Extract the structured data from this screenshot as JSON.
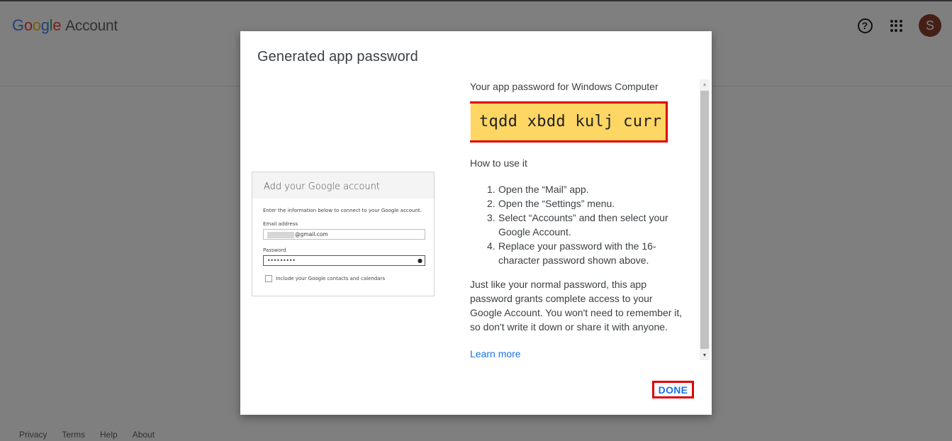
{
  "header": {
    "logo_letters": [
      "G",
      "o",
      "o",
      "g",
      "l",
      "e"
    ],
    "logo_suffix": "Account",
    "help_icon": "help-circle-icon",
    "apps_icon": "apps-grid-icon",
    "avatar_initial": "S",
    "avatar_color": "#8a3e2c"
  },
  "footer": {
    "links": [
      "Privacy",
      "Terms",
      "Help",
      "About"
    ]
  },
  "dialog": {
    "title": "Generated app password",
    "illustration": {
      "title": "Add your Google account",
      "description": "Enter the information below to connect to your Google account.",
      "email_label": "Email address",
      "email_value": "@gmail.com",
      "password_label": "Password",
      "password_value": "•••••••••",
      "checkbox_label": "Include your Google contacts and calendars"
    },
    "password_for": "Your app password for Windows Computer",
    "app_password": "tqdd xbdd kulj curr",
    "how_to_title": "How to use it",
    "steps": [
      {
        "num": "1.",
        "text": "Open the “Mail” app."
      },
      {
        "num": "2.",
        "text": "Open the “Settings” menu."
      },
      {
        "num": "3.",
        "text": "Select “Accounts” and then select your Google Account."
      },
      {
        "num": "4.",
        "text": "Replace your password with the 16-character password shown above."
      }
    ],
    "note": "Just like your normal password, this app password grants complete access to your Google Account. You won't need to remember it, so don't write it down or share it with anyone.",
    "learn_more": "Learn more",
    "done_label": "DONE",
    "colors": {
      "password_bg": "#fdd663",
      "highlight_border": "#e00000",
      "link": "#1a73e8"
    }
  }
}
